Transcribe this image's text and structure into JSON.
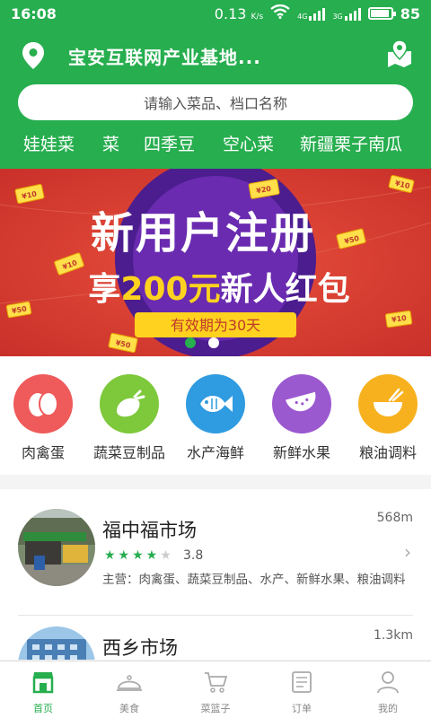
{
  "status": {
    "time": "16:08",
    "speed": "0.13",
    "speed_unit": "K/s",
    "net1": "4G",
    "net2": "3G",
    "battery": "85"
  },
  "header": {
    "location": "宝安互联网产业基地...",
    "location_icon": "pin-icon",
    "map_icon": "map-pin-icon"
  },
  "search": {
    "placeholder": "请输入菜品、档口名称"
  },
  "keywords": [
    "娃娃菜",
    "菜",
    "四季豆",
    "空心菜",
    "新疆栗子南瓜"
  ],
  "banner": {
    "line1": "新用户注册",
    "line2_pre": "享",
    "line2_amount": "200元",
    "line2_post": "新人红包",
    "validity": "有效期为30天",
    "coupon_labels": [
      "¥10",
      "¥20",
      "¥50",
      "¥10",
      "¥50",
      "¥10",
      "¥50",
      "¥10"
    ],
    "active_dot": 0,
    "dot_count": 2
  },
  "categories": [
    {
      "label": "肉禽蛋",
      "color": "#ef5a5a",
      "icon": "egg-icon"
    },
    {
      "label": "蔬菜豆制品",
      "color": "#7dc83b",
      "icon": "eggplant-icon"
    },
    {
      "label": "水产海鲜",
      "color": "#2f9be0",
      "icon": "fish-icon"
    },
    {
      "label": "新鲜水果",
      "color": "#9b59d0",
      "icon": "watermelon-icon"
    },
    {
      "label": "粮油调料",
      "color": "#f7b11f",
      "icon": "bowl-icon"
    }
  ],
  "markets": [
    {
      "name": "福中福市场",
      "distance": "568m",
      "rating": "3.8",
      "stars_filled": 4,
      "main": "主营：肉禽蛋、蔬菜豆制品、水产、新鲜水果、粮油调料"
    },
    {
      "name": "西乡市场",
      "distance": "1.3km"
    }
  ],
  "tabs": [
    {
      "label": "首页",
      "icon": "home-icon",
      "active": true
    },
    {
      "label": "美食",
      "icon": "cloche-icon",
      "active": false
    },
    {
      "label": "菜篮子",
      "icon": "cart-icon",
      "active": false
    },
    {
      "label": "订单",
      "icon": "order-icon",
      "active": false
    },
    {
      "label": "我的",
      "icon": "user-icon",
      "active": false
    }
  ],
  "colors": {
    "brand": "#27ae4f",
    "banner_red": "#d63b2e",
    "banner_yellow": "#ffd21f"
  }
}
